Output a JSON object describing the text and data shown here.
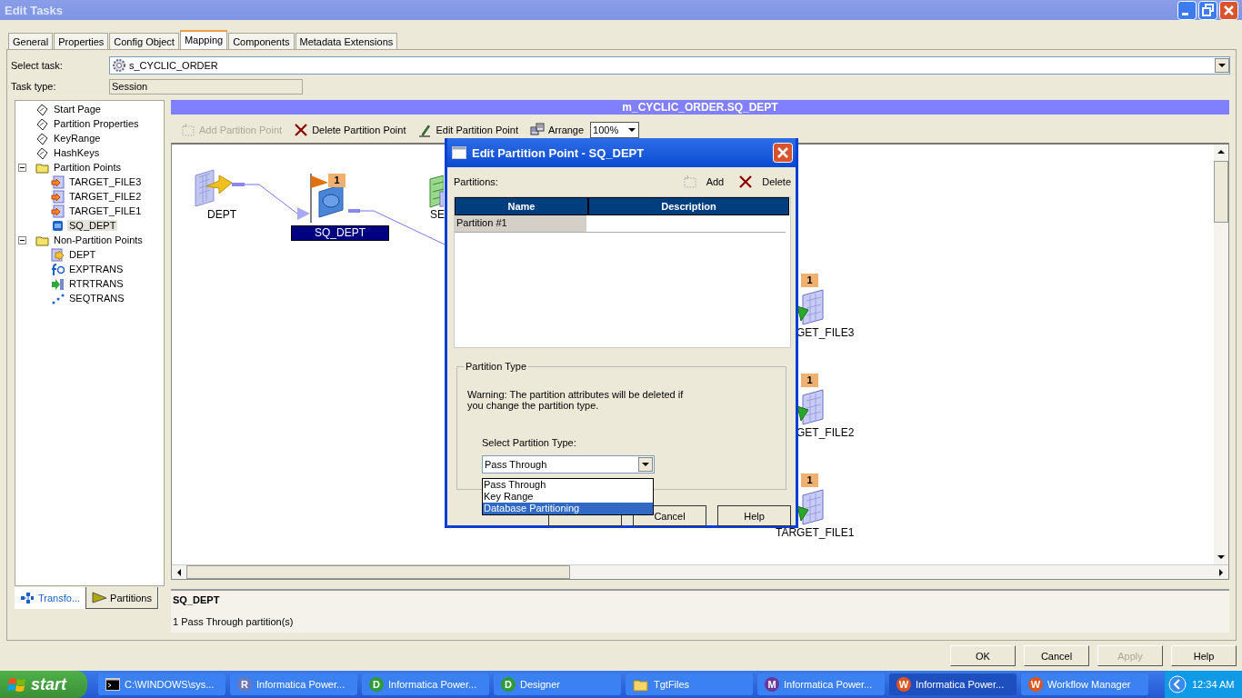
{
  "window": {
    "title": "Edit Tasks"
  },
  "tabs": [
    {
      "label": "General",
      "selected": false
    },
    {
      "label": "Properties",
      "selected": false
    },
    {
      "label": "Config Object",
      "selected": false
    },
    {
      "label": "Mapping",
      "selected": true
    },
    {
      "label": "Components",
      "selected": false
    },
    {
      "label": "Metadata Extensions",
      "selected": false
    }
  ],
  "select_task": {
    "label": "Select task:",
    "value": "s_CYCLIC_ORDER"
  },
  "task_type": {
    "label": "Task type:",
    "value": "Session"
  },
  "tree": [
    {
      "label": "Start Page",
      "kind": "page",
      "selected": false
    },
    {
      "label": "Partition Properties",
      "kind": "page",
      "selected": false
    },
    {
      "label": "KeyRange",
      "kind": "page",
      "selected": false
    },
    {
      "label": "HashKeys",
      "kind": "page",
      "selected": false
    },
    {
      "label": "Partition Points",
      "kind": "folder",
      "expanded": true,
      "selected": false,
      "children": [
        {
          "label": "TARGET_FILE3",
          "kind": "target",
          "selected": false
        },
        {
          "label": "TARGET_FILE2",
          "kind": "target",
          "selected": false
        },
        {
          "label": "TARGET_FILE1",
          "kind": "target",
          "selected": false
        },
        {
          "label": "SQ_DEPT",
          "kind": "qualifier",
          "selected": true
        }
      ]
    },
    {
      "label": "Non-Partition Points",
      "kind": "folder",
      "expanded": true,
      "selected": false,
      "children": [
        {
          "label": "DEPT",
          "kind": "source",
          "selected": false
        },
        {
          "label": "EXPTRANS",
          "kind": "expression",
          "selected": false
        },
        {
          "label": "RTRTRANS",
          "kind": "router",
          "selected": false
        },
        {
          "label": "SEQTRANS",
          "kind": "sequence",
          "selected": false
        }
      ]
    }
  ],
  "panel_tabs": [
    {
      "label": "Transfo...",
      "kind": "transformations",
      "selected": false
    },
    {
      "label": "Partitions",
      "kind": "partitions",
      "selected": true
    }
  ],
  "mapping_header": "m_CYCLIC_ORDER.SQ_DEPT",
  "toolbar": [
    {
      "label": "Add Partition Point",
      "kind": "add",
      "disabled": true
    },
    {
      "label": "Delete Partition Point",
      "kind": "delete",
      "disabled": false
    },
    {
      "label": "Edit Partition Point",
      "kind": "edit",
      "disabled": false
    },
    {
      "label": "Arrange",
      "kind": "arrange",
      "disabled": false
    }
  ],
  "zoom": {
    "value": "100%"
  },
  "canvas": {
    "nodes": [
      {
        "label": "DEPT",
        "kind": "source",
        "selected": false,
        "flag": false
      },
      {
        "label": "SQ_DEPT",
        "kind": "qualifier",
        "selected": true,
        "flag": true,
        "badge": "1"
      },
      {
        "label": "SE",
        "kind": "sequence",
        "selected": false,
        "flag": false
      },
      {
        "label": "GET_FILE3",
        "kind": "target",
        "selected": false,
        "flag": false,
        "badge": "1"
      },
      {
        "label": "GET_FILE2",
        "kind": "target",
        "selected": false,
        "flag": false,
        "badge": "1"
      },
      {
        "label": "TARGET_FILE1",
        "kind": "target",
        "selected": false,
        "flag": false,
        "badge": "1"
      }
    ]
  },
  "info": {
    "title": "SQ_DEPT",
    "text": "1 Pass Through partition(s)"
  },
  "buttons": [
    {
      "label": "OK",
      "disabled": false
    },
    {
      "label": "Cancel",
      "disabled": false
    },
    {
      "label": "Apply",
      "disabled": true
    },
    {
      "label": "Help",
      "disabled": false
    }
  ],
  "dialog": {
    "title": "Edit Partition Point - SQ_DEPT",
    "partitions_label": "Partitions:",
    "actions": [
      {
        "label": "Add",
        "kind": "add"
      },
      {
        "label": "Delete",
        "kind": "delete"
      }
    ],
    "columns": [
      "Name",
      "Description"
    ],
    "rows": [
      {
        "name": "Partition #1"
      }
    ],
    "group_label": "Partition Type",
    "warning": "Warning: The partition attributes will be deleted if you change the partition type.",
    "select_label": "Select Partition Type:",
    "select_value": "Pass Through",
    "options": [
      {
        "label": "Pass Through",
        "selected": false
      },
      {
        "label": "Key Range",
        "selected": false
      },
      {
        "label": "Database Partitioning",
        "selected": true
      }
    ],
    "buttons": [
      "Cancel",
      "Help"
    ]
  },
  "taskbar": {
    "start": "start",
    "items": [
      {
        "label": "C:\\WINDOWS\\sys...",
        "kind": "console",
        "selected": false
      },
      {
        "label": "Informatica Power...",
        "kind": "letter",
        "icon_text": "R",
        "color": "#6a78b8",
        "selected": false
      },
      {
        "label": "Informatica Power...",
        "kind": "letter",
        "icon_text": "D",
        "color": "#2e9a3a",
        "selected": false
      },
      {
        "label": "Designer",
        "kind": "letter",
        "icon_text": "D",
        "color": "#2e9a3a",
        "selected": false
      },
      {
        "label": "TgtFiles",
        "kind": "folder",
        "selected": false
      },
      {
        "label": "Informatica Power...",
        "kind": "letter",
        "icon_text": "M",
        "color": "#6a3a9a",
        "selected": false
      },
      {
        "label": "Informatica Power...",
        "kind": "letter",
        "icon_text": "W",
        "color": "#e0551e",
        "selected": true
      },
      {
        "label": "Workflow Manager",
        "kind": "letter",
        "icon_text": "W",
        "color": "#e0551e",
        "selected": false
      }
    ],
    "clock": "12:34 AM"
  }
}
